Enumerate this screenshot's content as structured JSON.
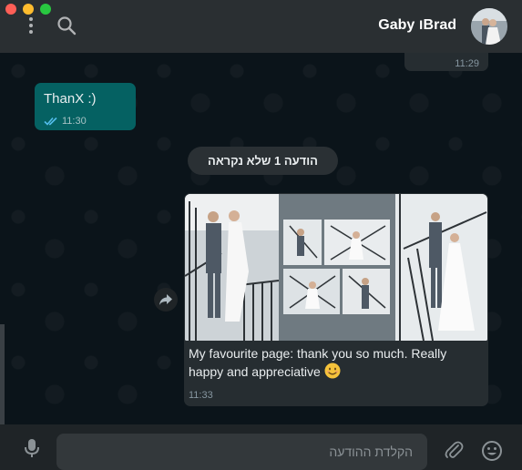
{
  "header": {
    "contact_name": "Gaby ו‎Brad",
    "icons": {
      "menu": "vertical-dots-icon",
      "search": "search-icon",
      "avatar": "couple-photo-avatar"
    }
  },
  "chat": {
    "previous_message": {
      "time": "11:29"
    },
    "outgoing_message": {
      "text": "ThanX :)",
      "time": "11:30",
      "status": "read-double-check"
    },
    "unread_divider": "הודעה 1 שלא נקראה",
    "incoming_message": {
      "media": "wedding-album-page-photo",
      "caption": "My favourite page: thank you so much. Really happy and appreciative",
      "emoji": "smiling-face-emoji",
      "time": "11:33"
    }
  },
  "composer": {
    "placeholder": "הקלדת ההודעה",
    "icons": {
      "mic": "microphone-icon",
      "attach": "paperclip-icon",
      "emoji": "smiley-icon"
    }
  },
  "colors": {
    "header_bg": "#2a2f32",
    "chat_bg": "#0b141a",
    "outgoing_bubble": "#056162",
    "incoming_bubble": "#262d31",
    "footer_bg": "#1f2427",
    "read_tick": "#53bdeb"
  }
}
